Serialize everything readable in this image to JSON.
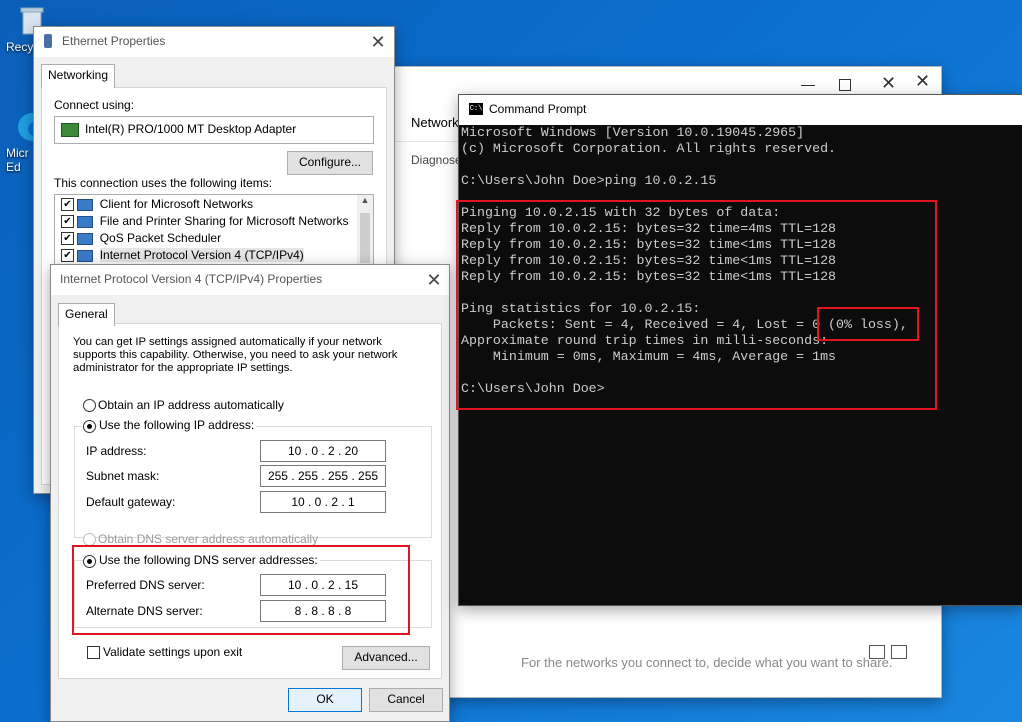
{
  "desktop": {
    "icons": [
      {
        "label": "Recy"
      },
      {
        "label": "Micr Ed"
      }
    ]
  },
  "ethernet": {
    "title": "Ethernet Properties",
    "tab": "Networking",
    "connect_using_label": "Connect using:",
    "adapter": "Intel(R) PRO/1000 MT Desktop Adapter",
    "configure_btn": "Configure...",
    "items_label": "This connection uses the following items:",
    "items": [
      {
        "label": "Client for Microsoft Networks"
      },
      {
        "label": "File and Printer Sharing for Microsoft Networks"
      },
      {
        "label": "QoS Packet Scheduler"
      },
      {
        "label": "Internet Protocol Version 4 (TCP/IPv4)"
      }
    ]
  },
  "settings_bg": {
    "network_text": "Network",
    "diagnose_text": "Diagnose",
    "bottom_text": "For the networks you connect to, decide what you want to share."
  },
  "ipv4": {
    "title": "Internet Protocol Version 4 (TCP/IPv4) Properties",
    "tab": "General",
    "intro": "You can get IP settings assigned automatically if your network supports this capability. Otherwise, you need to ask your network administrator for the appropriate IP settings.",
    "obtain_ip": "Obtain an IP address automatically",
    "use_ip": "Use the following IP address:",
    "ip_label": "IP address:",
    "ip_value": "10  .  0  .  2  .  20",
    "mask_label": "Subnet mask:",
    "mask_value": "255 . 255 . 255 . 255",
    "gateway_label": "Default gateway:",
    "gateway_value": "10  .  0  .  2  .  1",
    "obtain_dns": "Obtain DNS server address automatically",
    "use_dns": "Use the following DNS server addresses:",
    "pref_dns_label": "Preferred DNS server:",
    "pref_dns_value": "10  .  0  .  2  .  15",
    "alt_dns_label": "Alternate DNS server:",
    "alt_dns_value": "8  .  8  .  8  .  8",
    "validate_label": "Validate settings upon exit",
    "advanced_btn": "Advanced...",
    "ok_btn": "OK",
    "cancel_btn": "Cancel"
  },
  "cmd": {
    "title": "Command Prompt",
    "icon_text": "C:\\",
    "lines": [
      "Microsoft Windows [Version 10.0.19045.2965]",
      "(c) Microsoft Corporation. All rights reserved.",
      "",
      "C:\\Users\\John Doe>ping 10.0.2.15",
      "",
      "Pinging 10.0.2.15 with 32 bytes of data:",
      "Reply from 10.0.2.15: bytes=32 time=4ms TTL=128",
      "Reply from 10.0.2.15: bytes=32 time<1ms TTL=128",
      "Reply from 10.0.2.15: bytes=32 time<1ms TTL=128",
      "Reply from 10.0.2.15: bytes=32 time<1ms TTL=128",
      "",
      "Ping statistics for 10.0.2.15:",
      "    Packets: Sent = 4, Received = 4, Lost = 0 (0% loss),",
      "Approximate round trip times in milli-seconds:",
      "    Minimum = 0ms, Maximum = 4ms, Average = 1ms",
      "",
      "C:\\Users\\John Doe>"
    ]
  },
  "colors": {
    "highlight_red": "#e0151d",
    "desktop_blue": "#0b6fd0",
    "console_bg": "#0c0c0c",
    "console_fg": "#cccccc"
  }
}
